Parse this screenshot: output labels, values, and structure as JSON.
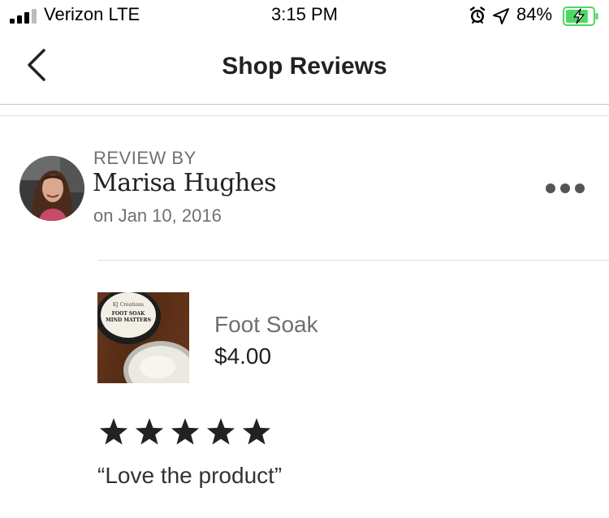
{
  "status_bar": {
    "carrier": "Verizon LTE",
    "time": "3:15 PM",
    "battery": "84%",
    "battery_level": 0.84,
    "signal_bars": 3,
    "icons": [
      "signal-icon",
      "alarm-icon",
      "location-arrow-icon",
      "battery-charging-icon"
    ],
    "battery_color": "#4cd964"
  },
  "nav": {
    "back_icon": "chevron-left-icon",
    "title": "Shop Reviews"
  },
  "review": {
    "label": "REVIEW BY",
    "reviewer": "Marisa Hughes",
    "date": "on Jan 10, 2016",
    "more_icon": "more-horizontal-icon",
    "avatar": "reviewer-photo",
    "product": {
      "thumbnail": "foot-soak-jar-photo",
      "thumbnail_label_lines": [
        "KJ Creations",
        "FOOT SOAK",
        "MIND MATTERS"
      ],
      "name": "Foot Soak",
      "price": "$4.00"
    },
    "rating": 5,
    "rating_max": 5,
    "text": "“Love the product”"
  },
  "colors": {
    "text_primary": "#222222",
    "text_secondary": "#707070",
    "star": "#222222"
  }
}
